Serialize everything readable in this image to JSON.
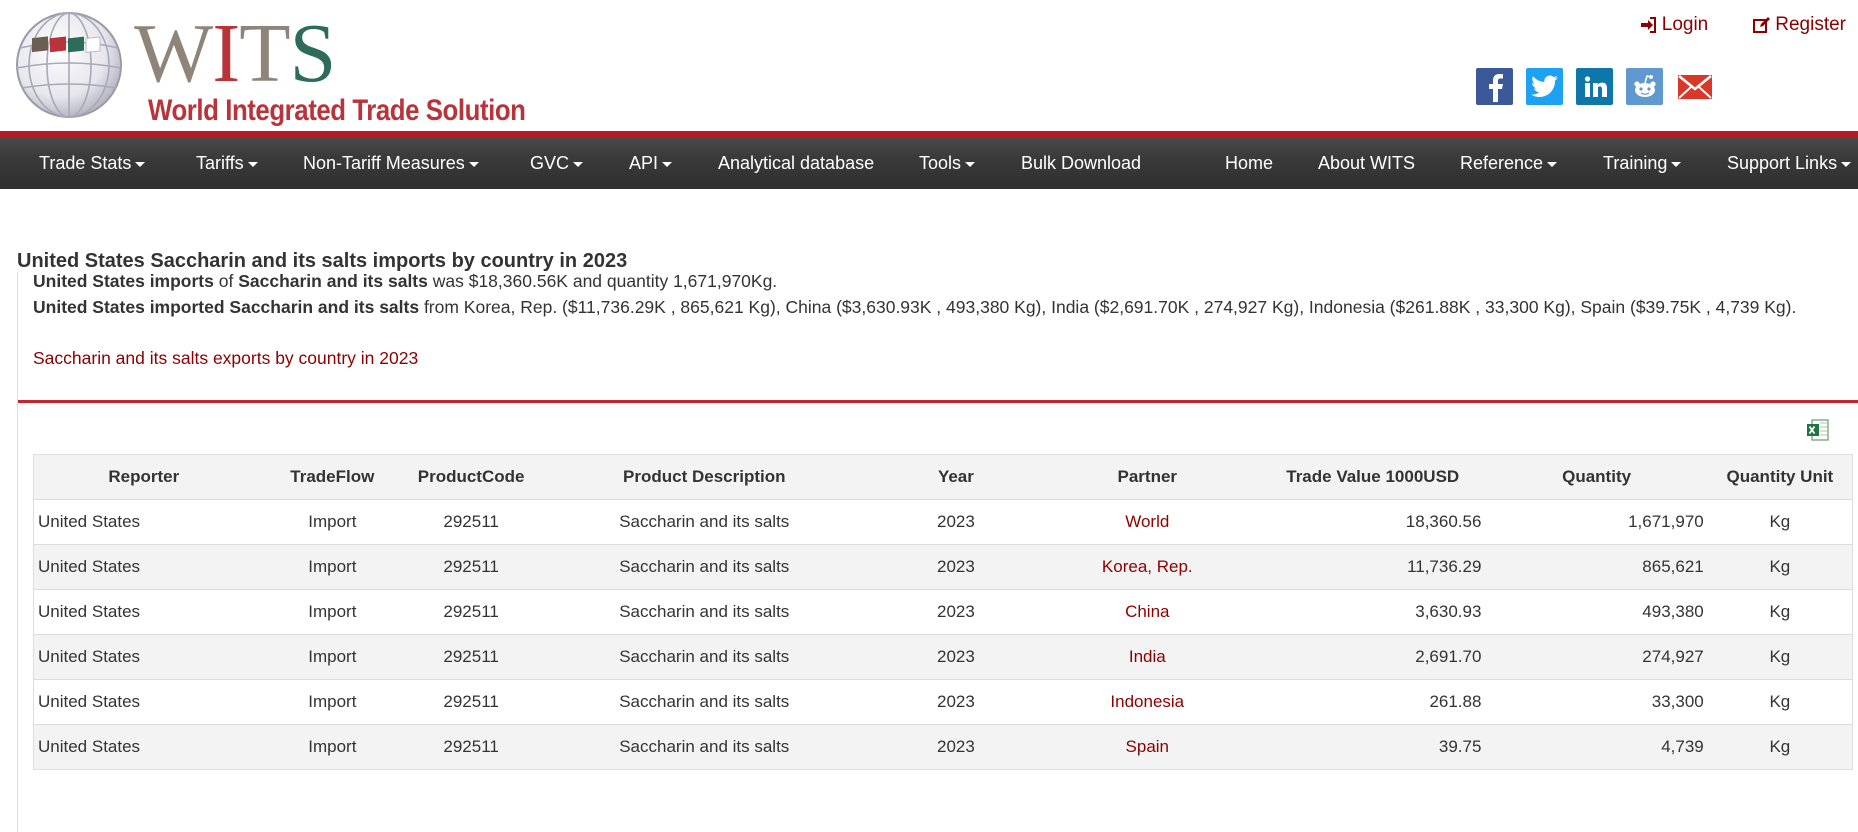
{
  "brand": {
    "logo_letters": [
      "W",
      "I",
      "T",
      "S"
    ],
    "logo_subtitle": "World Integrated Trade Solution",
    "colors": {
      "red": "#b8333a",
      "taupe": "#8f8478",
      "green": "#2e6b5a",
      "nav_bg": "#3a3a3a",
      "link": "#8b0000"
    }
  },
  "top_links": {
    "login": "Login",
    "register": "Register"
  },
  "social": [
    "facebook-icon",
    "twitter-icon",
    "linkedin-icon",
    "reddit-icon",
    "email-icon"
  ],
  "nav": {
    "items": [
      {
        "label": "Trade Stats",
        "dropdown": true
      },
      {
        "label": "Tariffs",
        "dropdown": true
      },
      {
        "label": "Non-Tariff Measures",
        "dropdown": true
      },
      {
        "label": "GVC",
        "dropdown": true
      },
      {
        "label": "API",
        "dropdown": true
      },
      {
        "label": "Analytical database",
        "dropdown": false
      },
      {
        "label": "Tools",
        "dropdown": true
      },
      {
        "label": "Bulk Download",
        "dropdown": false
      },
      {
        "label": "Home",
        "dropdown": false
      },
      {
        "label": "About WITS",
        "dropdown": false
      },
      {
        "label": "Reference",
        "dropdown": true
      },
      {
        "label": "Training",
        "dropdown": true
      },
      {
        "label": "Support Links",
        "dropdown": true
      }
    ]
  },
  "content": {
    "title": "United States Saccharin and its salts imports by country in 2023",
    "summary1": {
      "bold_a": "United States imports",
      "text_a": " of ",
      "bold_b": "Saccharin and its salts",
      "text_b": " was $18,360.56K and quantity 1,671,970Kg."
    },
    "summary2": {
      "bold": "United States imported Saccharin and its salts",
      "text": " from Korea, Rep. ($11,736.29K , 865,621 Kg), China ($3,630.93K , 493,380 Kg), India ($2,691.70K , 274,927 Kg), Indonesia ($261.88K , 33,300 Kg), Spain ($39.75K , 4,739 Kg)."
    },
    "exports_link": "Saccharin and its salts exports by country in 2023"
  },
  "table": {
    "headers": [
      "Reporter",
      "TradeFlow",
      "ProductCode",
      "Product Description",
      "Year",
      "Partner",
      "Trade Value 1000USD",
      "Quantity",
      "Quantity Unit"
    ],
    "rows": [
      [
        "United States",
        "Import",
        "292511",
        "Saccharin and its salts",
        "2023",
        "World",
        "18,360.56",
        "1,671,970",
        "Kg"
      ],
      [
        "United States",
        "Import",
        "292511",
        "Saccharin and its salts",
        "2023",
        "Korea, Rep.",
        "11,736.29",
        "865,621",
        "Kg"
      ],
      [
        "United States",
        "Import",
        "292511",
        "Saccharin and its salts",
        "2023",
        "China",
        "3,630.93",
        "493,380",
        "Kg"
      ],
      [
        "United States",
        "Import",
        "292511",
        "Saccharin and its salts",
        "2023",
        "India",
        "2,691.70",
        "274,927",
        "Kg"
      ],
      [
        "United States",
        "Import",
        "292511",
        "Saccharin and its salts",
        "2023",
        "Indonesia",
        "261.88",
        "33,300",
        "Kg"
      ],
      [
        "United States",
        "Import",
        "292511",
        "Saccharin and its salts",
        "2023",
        "Spain",
        "39.75",
        "4,739",
        "Kg"
      ]
    ]
  }
}
